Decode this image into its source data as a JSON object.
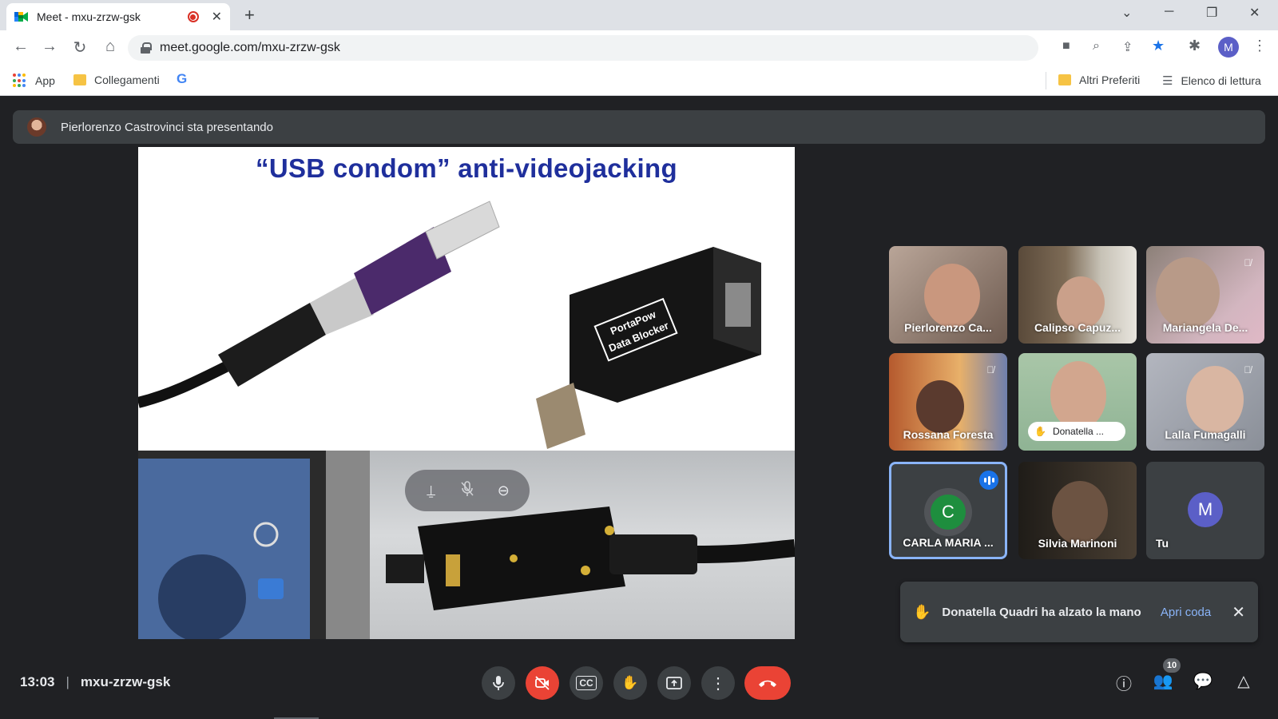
{
  "browser": {
    "tab_title": "Meet - mxu-zrzw-gsk",
    "url": "meet.google.com/mxu-zrzw-gsk",
    "profile_initial": "M",
    "bookmarks": {
      "apps_label": "App",
      "folder_label": "Collegamenti",
      "google_label": "G",
      "other_label": "Altri Preferiti",
      "reading_list_label": "Elenco di lettura"
    }
  },
  "meet": {
    "presenting_text": "Pierlorenzo Castrovinci sta presentando",
    "slide_title": "“USB condom” anti-videojacking",
    "product_label_line1": "PortaPow",
    "product_label_line2": "Data Blocker",
    "participants": [
      {
        "name": "Pierlorenzo Ca...",
        "muted": false
      },
      {
        "name": "Calipso Capuz...",
        "muted": false
      },
      {
        "name": "Mariangela De...",
        "muted": true
      },
      {
        "name": "Rossana Foresta",
        "muted": true
      },
      {
        "name": "Donatella ...",
        "muted": false,
        "hand_raised": true
      },
      {
        "name": "Lalla Fumagalli",
        "muted": true
      },
      {
        "name": "CARLA MARIA ...",
        "initial": "C",
        "speaking": true
      },
      {
        "name": "Silvia Marinoni",
        "muted": false
      },
      {
        "name": "Tu",
        "initial": "M"
      }
    ],
    "toast": {
      "message": "Donatella Quadri ha alzato la mano",
      "action": "Apri coda"
    },
    "time": "13:03",
    "meeting_code": "mxu-zrzw-gsk",
    "people_count": "10",
    "colors": {
      "accent_blue": "#8ab4f8",
      "end_call_red": "#ea4335",
      "carla_avatar": "#1e8e3e",
      "you_avatar": "#5b5fc7"
    }
  }
}
